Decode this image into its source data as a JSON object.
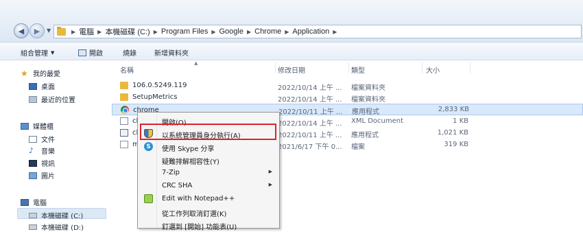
{
  "address": {
    "path": [
      "電腦",
      "本機磁碟 (C:)",
      "Program Files",
      "Google",
      "Chrome",
      "Application"
    ]
  },
  "toolbar": {
    "organize": "組合管理",
    "open": "開啟",
    "share": "燒錄",
    "new_folder": "新增資料夾"
  },
  "navpane": {
    "favorites": "我的最愛",
    "desktop": "桌面",
    "recent": "最近的位置",
    "libraries": "媒體櫃",
    "documents": "文件",
    "music": "音樂",
    "videos": "視訊",
    "pictures": "圖片",
    "computer": "電腦",
    "drive_c": "本機磁碟 (C:)",
    "drive_d": "本機磁碟 (D:)"
  },
  "columns": {
    "name": "名稱",
    "date": "修改日期",
    "type": "類型",
    "size": "大小"
  },
  "files": [
    {
      "name": "106.0.5249.119",
      "date": "2022/10/14 上午 ...",
      "type": "檔案資料夾",
      "size": "",
      "icon": "folder-icon"
    },
    {
      "name": "SetupMetrics",
      "date": "2022/10/14 上午 ...",
      "type": "檔案資料夾",
      "size": "",
      "icon": "folder-icon"
    },
    {
      "name": "chrome",
      "date": "2022/10/11 上午 ...",
      "type": "應用程式",
      "size": "2,833 KB",
      "icon": "chrome-icon"
    },
    {
      "name": "ch",
      "date": "2022/10/14 上午 ...",
      "type": "XML Document",
      "size": "1 KB",
      "icon": "xml-icon"
    },
    {
      "name": "ch",
      "date": "2022/10/11 上午 ...",
      "type": "應用程式",
      "size": "1,021 KB",
      "icon": "exe-icon"
    },
    {
      "name": "ma",
      "date": "2021/6/17 下午 0...",
      "type": "檔案",
      "size": "319 KB",
      "icon": "file-icon"
    }
  ],
  "context_menu": {
    "items": [
      {
        "label": "開啟(O)",
        "icon": "",
        "submenu": false
      },
      {
        "label": "以系統管理員身分執行(A)",
        "icon": "uac-shield-icon",
        "submenu": false
      },
      {
        "label": "使用 Skype 分享",
        "icon": "skype-icon",
        "submenu": false
      },
      {
        "label": "疑難排解相容性(Y)",
        "icon": "",
        "submenu": false
      },
      {
        "label": "7-Zip",
        "icon": "",
        "submenu": true
      },
      {
        "label": "CRC SHA",
        "icon": "",
        "submenu": true
      },
      {
        "label": "Edit with Notepad++",
        "icon": "notepad-plus-plus-icon",
        "submenu": false
      },
      {
        "label": "從工作列取消釘選(K)",
        "icon": "",
        "submenu": false
      },
      {
        "label": "釘選到 [開始] 功能表(U)",
        "icon": "",
        "submenu": false
      }
    ],
    "highlight_color": "#d9242a"
  }
}
